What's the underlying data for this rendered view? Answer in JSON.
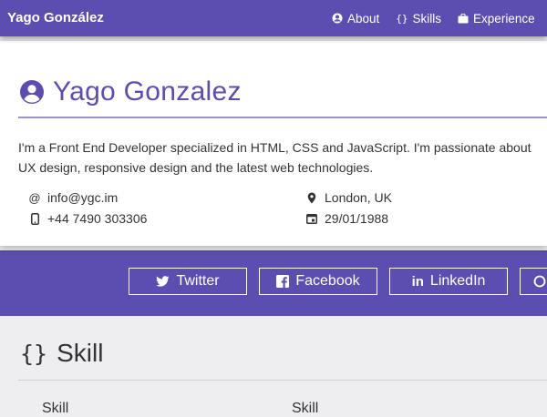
{
  "brand": "Yago González",
  "nav": [
    {
      "label": "About",
      "icon": "user-circle-icon"
    },
    {
      "label": "Skills",
      "icon": "braces-icon"
    },
    {
      "label": "Experience",
      "icon": "briefcase-icon"
    }
  ],
  "profile": {
    "name": "Yago Gonzalez",
    "bio": "I'm a Front End Developer specialized in HTML, CSS and JavaScript. I'm passionate about UX design, responsive design and the latest web technologies.",
    "email": "info@ygc.im",
    "phone": "+44 7490 303306",
    "location": "London, UK",
    "birthdate": "29/01/1988"
  },
  "social": [
    {
      "label": "Twitter",
      "icon": "twitter-icon"
    },
    {
      "label": "Facebook",
      "icon": "facebook-icon"
    },
    {
      "label": "LinkedIn",
      "icon": "linkedin-icon"
    }
  ],
  "skills_section": {
    "braces": "{}",
    "title": "Skill",
    "items": [
      "Skill",
      "Skill"
    ]
  },
  "colors": {
    "primary": "#5c4db1",
    "rule": "#9a90d4",
    "page_bg": "#eeeef0"
  }
}
